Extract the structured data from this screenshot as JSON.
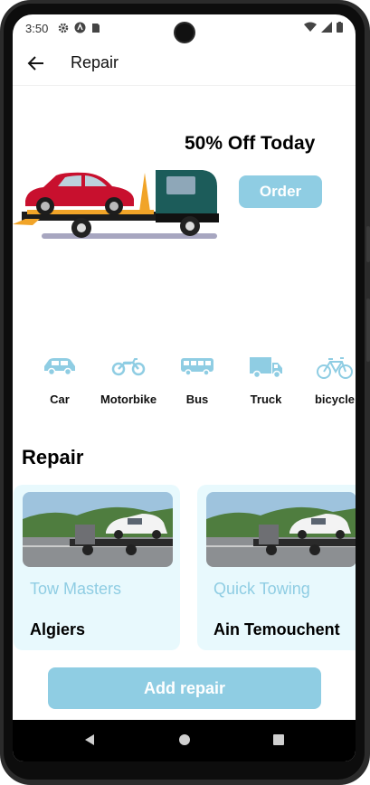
{
  "status_bar": {
    "time": "3:50"
  },
  "app_bar": {
    "title": "Repair"
  },
  "banner": {
    "title": "50% Off Today",
    "order_label": "Order"
  },
  "categories": [
    {
      "label": "Car",
      "icon": "car-icon"
    },
    {
      "label": "Motorbike",
      "icon": "motorbike-icon"
    },
    {
      "label": "Bus",
      "icon": "bus-icon"
    },
    {
      "label": "Truck",
      "icon": "truck-icon"
    },
    {
      "label": "bicycle",
      "icon": "bicycle-icon"
    }
  ],
  "section": {
    "title": "Repair"
  },
  "repairs": [
    {
      "name": "Tow Masters",
      "city": "Algiers"
    },
    {
      "name": "Quick Towing",
      "city": "Ain Temouchent"
    }
  ],
  "add_button": {
    "label": "Add repair"
  },
  "colors": {
    "accent": "#8fcde3",
    "card_bg": "#e8f9fd",
    "truck_cab": "#1c5c5a",
    "car_red": "#c8102e"
  }
}
